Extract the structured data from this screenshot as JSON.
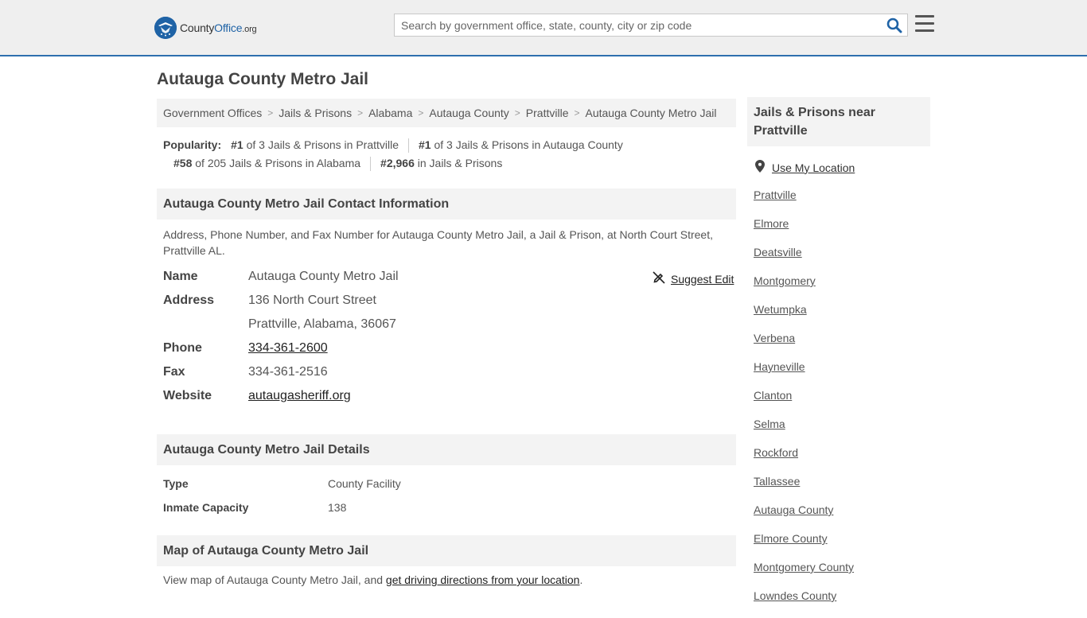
{
  "header": {
    "logo": {
      "county": "County",
      "office": "Office",
      "tld": ".org"
    },
    "search_placeholder": "Search by government office, state, county, city or zip code"
  },
  "page_title": "Autauga County Metro Jail",
  "breadcrumb": [
    "Government Offices",
    "Jails & Prisons",
    "Alabama",
    "Autauga County",
    "Prattville",
    "Autauga County Metro Jail"
  ],
  "popularity": {
    "label": "Popularity:",
    "items": [
      {
        "rank": "#1",
        "text": "of 3 Jails & Prisons in Prattville"
      },
      {
        "rank": "#1",
        "text": "of 3 Jails & Prisons in Autauga County"
      },
      {
        "rank": "#58",
        "text": "of 205 Jails & Prisons in Alabama"
      },
      {
        "rank": "#2,966",
        "text": "in Jails & Prisons"
      }
    ]
  },
  "contact": {
    "heading": "Autauga County Metro Jail Contact Information",
    "description": "Address, Phone Number, and Fax Number for Autauga County Metro Jail, a Jail & Prison, at North Court Street, Prattville AL.",
    "suggest_edit": "Suggest Edit",
    "name_label": "Name",
    "name": "Autauga County Metro Jail",
    "address_label": "Address",
    "address_line1": "136 North Court Street",
    "address_line2": "Prattville, Alabama, 36067",
    "phone_label": "Phone",
    "phone": "334-361-2600",
    "fax_label": "Fax",
    "fax": "334-361-2516",
    "website_label": "Website",
    "website": "autaugasheriff.org"
  },
  "details": {
    "heading": "Autauga County Metro Jail Details",
    "type_label": "Type",
    "type": "County Facility",
    "capacity_label": "Inmate Capacity",
    "capacity": "138"
  },
  "map": {
    "heading": "Map of Autauga County Metro Jail",
    "text_before": "View map of Autauga County Metro Jail, and ",
    "link": "get driving directions from your location",
    "text_after": "."
  },
  "sidebar": {
    "heading": "Jails & Prisons near Prattville",
    "use_location": "Use My Location",
    "places": [
      "Prattville",
      "Elmore",
      "Deatsville",
      "Montgomery",
      "Wetumpka",
      "Verbena",
      "Hayneville",
      "Clanton",
      "Selma",
      "Rockford",
      "Tallassee",
      "Autauga County",
      "Elmore County",
      "Montgomery County",
      "Lowndes County"
    ]
  },
  "colors": {
    "brand": "#1f63a6",
    "header_bg": "#efefef",
    "panel_bg": "#f3f3f3"
  }
}
